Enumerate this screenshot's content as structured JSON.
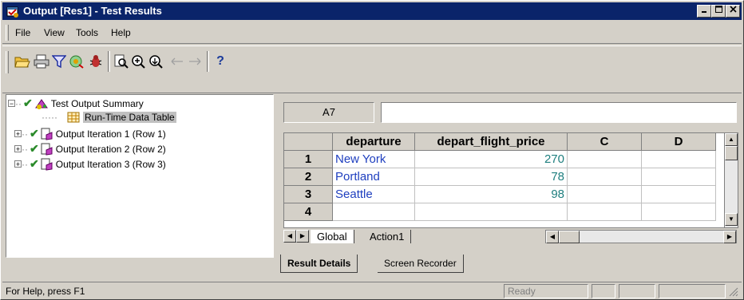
{
  "window": {
    "title": "Output [Res1] - Test Results",
    "controls": [
      "minimize",
      "maximize",
      "close"
    ]
  },
  "menu": {
    "items": [
      {
        "label": "File",
        "accel": "F"
      },
      {
        "label": "View",
        "accel": "V"
      },
      {
        "label": "Tools",
        "accel": "T"
      },
      {
        "label": "Help",
        "accel": "H"
      }
    ]
  },
  "toolbar": {
    "icons": [
      "open-icon",
      "print-icon",
      "filter-icon",
      "report-icon",
      "bug-icon",
      "find-icon",
      "zoom-in-icon",
      "zoom-out-icon",
      "back-arrow-icon",
      "forward-arrow-icon",
      "help-icon"
    ],
    "help_label": "?"
  },
  "tree": {
    "root": "Test Output Summary",
    "child": "Run-Time Data Table",
    "iterations": [
      "Output Iteration 1 (Row 1)",
      "Output Iteration 2 (Row 2)",
      "Output Iteration 3 (Row 3)"
    ]
  },
  "datatable": {
    "cell_ref": "A7",
    "formula_value": "",
    "columns": [
      "departure",
      "depart_flight_price",
      "C",
      "D"
    ],
    "rows": [
      {
        "num": "1",
        "departure": "New York",
        "price": "270"
      },
      {
        "num": "2",
        "departure": "Portland",
        "price": "78"
      },
      {
        "num": "3",
        "departure": "Seattle",
        "price": "98"
      },
      {
        "num": "4",
        "departure": "",
        "price": ""
      }
    ],
    "sheets": [
      "Global",
      "Action1"
    ]
  },
  "bottom_tabs": [
    "Result Details",
    "Screen Recorder"
  ],
  "status": {
    "help_text": "For Help, press F1",
    "state": "Ready"
  },
  "colors": {
    "title_bg": "#0a246a",
    "check": "#2a8a2a",
    "text_value": "#1f3fbf",
    "number_value": "#1f7f7f"
  }
}
